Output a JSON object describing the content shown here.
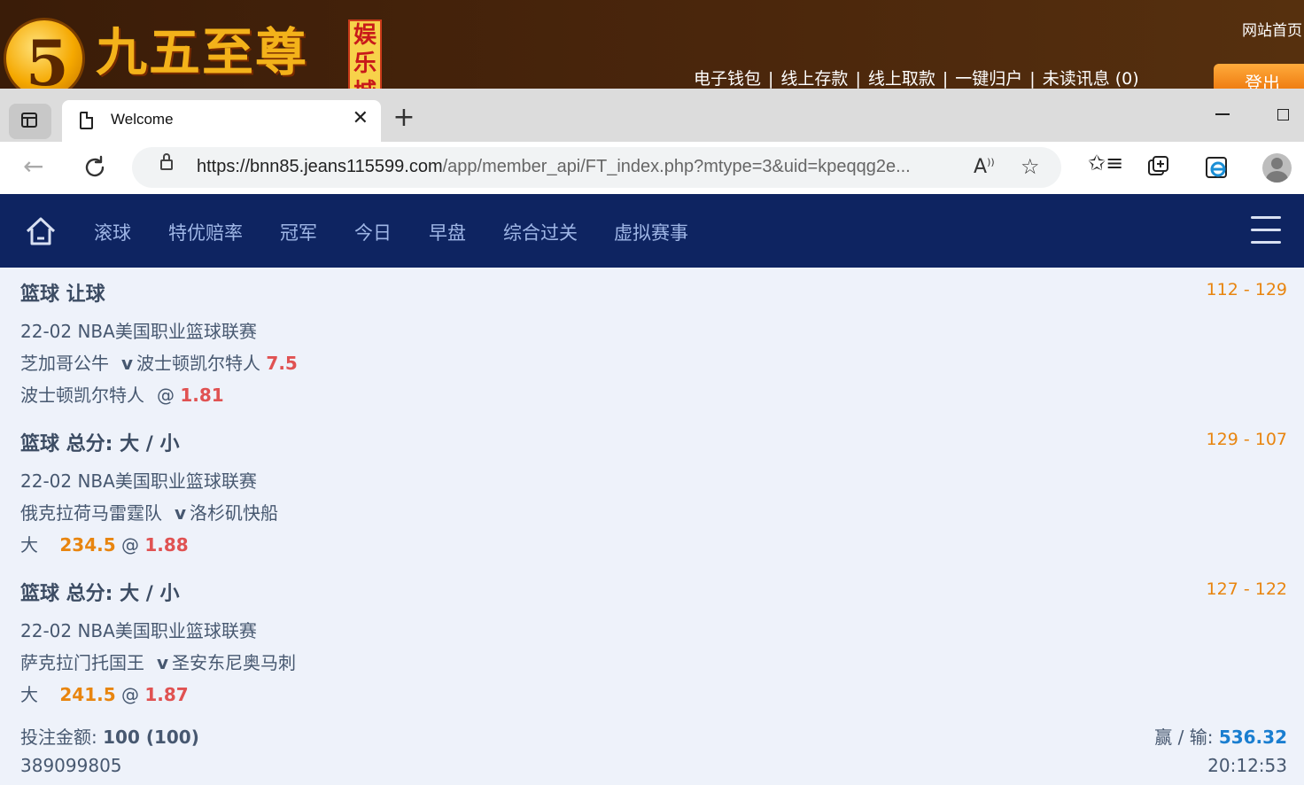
{
  "site_banner": {
    "logo_number": "5",
    "logo_text": "九五至尊",
    "logo_badge": "娱乐城",
    "home_link": "网站首页",
    "member_links": [
      "电子钱包",
      "线上存款",
      "线上取款",
      "一键归户",
      "未读讯息 (0)"
    ],
    "logout": "登出"
  },
  "browser": {
    "tab_title": "Welcome",
    "url_host": "https://bnn85.jeans115599.com",
    "url_path": "/app/member_api/FT_index.php?mtype=3&uid=kpeqqg2e..."
  },
  "nav": {
    "items": [
      "滚球",
      "特优赔率",
      "冠军",
      "今日",
      "早盘",
      "综合过关",
      "虚拟赛事"
    ]
  },
  "bets": [
    {
      "title": "篮球 让球",
      "score": "112 - 129",
      "league": "22-02 NBA美国职业篮球联赛",
      "home": "芝加哥公牛",
      "vs": "v",
      "away": "波士顿凯尔特人",
      "handicap": "7.5",
      "pick": "波士顿凯尔特人",
      "pick_line": "",
      "at": "@",
      "odds": "1.81"
    },
    {
      "title": "篮球 总分: 大 / 小",
      "score": "129 - 107",
      "league": "22-02 NBA美国职业篮球联赛",
      "home": "俄克拉荷马雷霆队",
      "vs": "v",
      "away": "洛杉矶快船",
      "handicap": "",
      "pick": "大",
      "pick_line": "234.5",
      "at": "@",
      "odds": "1.88"
    },
    {
      "title": "篮球 总分: 大 / 小",
      "score": "127 - 122",
      "league": "22-02 NBA美国职业篮球联赛",
      "home": "萨克拉门托国王",
      "vs": "v",
      "away": "圣安东尼奥马刺",
      "handicap": "",
      "pick": "大",
      "pick_line": "241.5",
      "at": "@",
      "odds": "1.87"
    }
  ],
  "summary": {
    "stake_label": "投注金额:",
    "stake_value": "100 (100)",
    "result_label": "赢 / 输:",
    "result_value": "536.32",
    "ticket_id": "389099805",
    "time": "20:12:53"
  },
  "colors": {
    "nav_bg": "#0e2461",
    "score": "#e8850f",
    "odds": "#e05252",
    "win": "#1a7ed0"
  }
}
